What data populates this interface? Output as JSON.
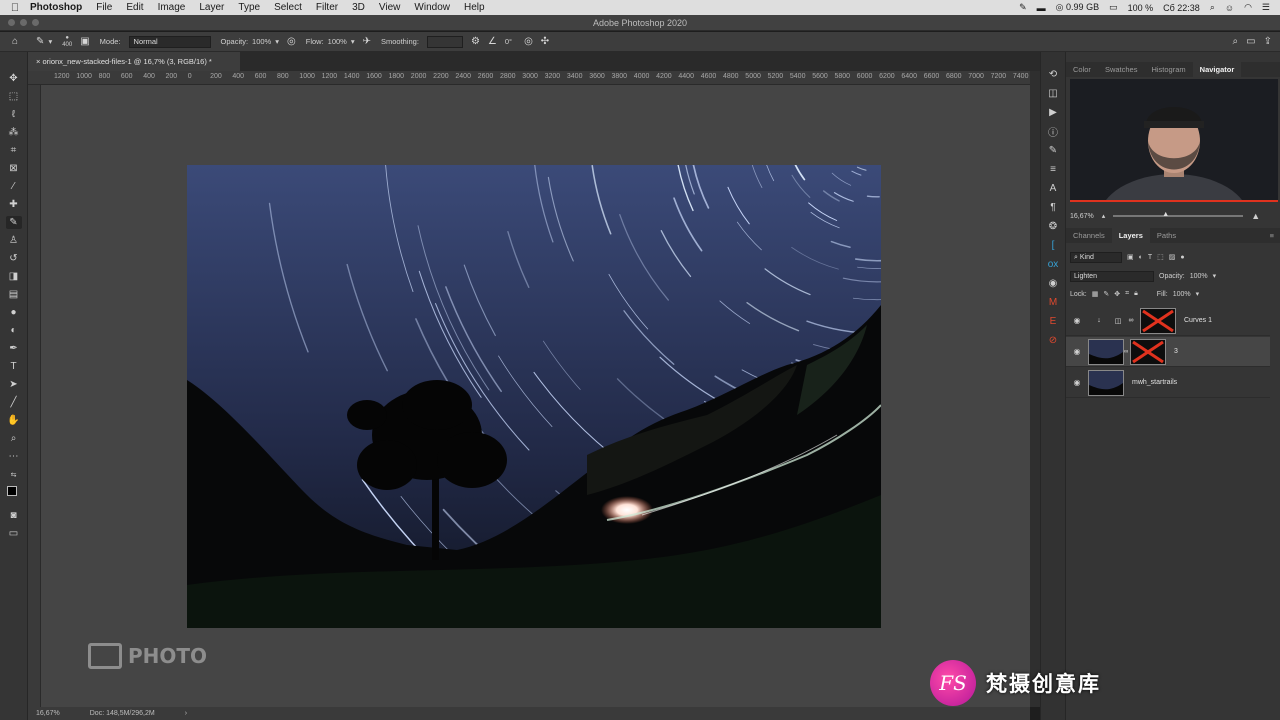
{
  "menubar": {
    "app_name": "Photoshop",
    "items": [
      "File",
      "Edit",
      "Image",
      "Layer",
      "Type",
      "Select",
      "Filter",
      "3D",
      "View",
      "Window",
      "Help"
    ],
    "memory": "0.99 GB",
    "battery": "100 %",
    "clock": "Сб 22:38"
  },
  "window": {
    "title": "Adobe Photoshop 2020"
  },
  "options_bar": {
    "brush_size": "400",
    "mode_label": "Mode:",
    "mode_value": "Normal",
    "opacity_label": "Opacity:",
    "opacity_value": "100%",
    "flow_label": "Flow:",
    "flow_value": "100%",
    "smoothing_label": "Smoothing:",
    "angle_value": "0°"
  },
  "document": {
    "tab_title": "orionx_new-stacked-files-1 @ 16,7% (3, RGB/16) *",
    "ruler_ticks": [
      "1200",
      "1000",
      "800",
      "600",
      "400",
      "200",
      "0",
      "200",
      "400",
      "600",
      "800",
      "1000",
      "1200",
      "1400",
      "1600",
      "1800",
      "2000",
      "2200",
      "2400",
      "2600",
      "2800",
      "3000",
      "3200",
      "3400",
      "3600",
      "3800",
      "4000",
      "4200",
      "4400",
      "4600",
      "4800",
      "5000",
      "5200",
      "5400",
      "5600",
      "5800",
      "6000",
      "6200",
      "6400",
      "6600",
      "6800",
      "7000",
      "7200",
      "7400"
    ],
    "watermark_text": "PHOTO"
  },
  "status": {
    "zoom": "16,67%",
    "doc_size": "Doc: 148,5M/296,2M"
  },
  "navigator": {
    "tabs": [
      "Color",
      "Swatches",
      "Histogram",
      "Navigator"
    ],
    "active_tab": "Navigator",
    "zoom": "16,67%",
    "zoom_level_fraction": 0.4
  },
  "layers_panel": {
    "tabs": [
      "Channels",
      "Layers",
      "Paths"
    ],
    "active_tab": "Layers",
    "filter_kind": "Kind",
    "blend_mode": "Lighten",
    "opacity_label": "Opacity:",
    "opacity_value": "100%",
    "lock_label": "Lock:",
    "fill_label": "Fill:",
    "fill_value": "100%",
    "layers": [
      {
        "name": "Curves 1",
        "type": "adjustment"
      },
      {
        "name": "3",
        "type": "image-with-mask"
      },
      {
        "name": "mwh_startrails",
        "type": "image"
      }
    ]
  },
  "brand": {
    "logo_text": "FS",
    "text": "梵摄创意库"
  },
  "colors": {
    "accent_red": "#e0321e",
    "teal": "#37a2d6"
  }
}
